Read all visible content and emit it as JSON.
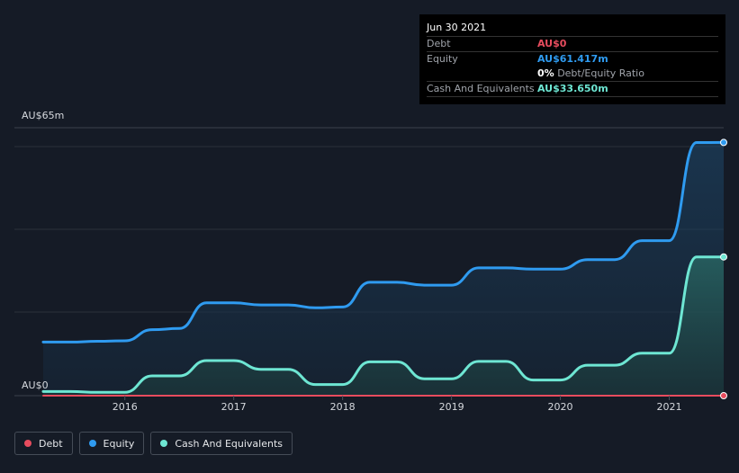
{
  "tooltip": {
    "date": "Jun 30 2021",
    "rows": [
      {
        "label": "Debt",
        "value": "AU$0",
        "color": "#e74c5e"
      },
      {
        "label": "Equity",
        "value": "AU$61.417m",
        "color": "#2f9bf0"
      },
      {
        "ratio_value": "0%",
        "ratio_label": "Debt/Equity Ratio"
      },
      {
        "label": "Cash And Equivalents",
        "value": "AU$33.650m",
        "color": "#6ee6d3"
      }
    ]
  },
  "legend": [
    {
      "label": "Debt",
      "color": "#e74c5e"
    },
    {
      "label": "Equity",
      "color": "#2f9bf0"
    },
    {
      "label": "Cash And Equivalents",
      "color": "#6ee6d3"
    }
  ],
  "chart_data": {
    "type": "area",
    "y_axis_labels": [
      "AU$65m",
      "AU$0"
    ],
    "x_tick_labels": [
      "2016",
      "2017",
      "2018",
      "2019",
      "2020",
      "2021"
    ],
    "ylim": [
      0,
      65
    ],
    "xlim": [
      2015.25,
      2021.5
    ],
    "grid": true,
    "series": [
      {
        "name": "Debt",
        "color": "#e74c5e",
        "fill": false,
        "x": [
          2015.25,
          2021.5
        ],
        "values": [
          0,
          0
        ]
      },
      {
        "name": "Equity",
        "color": "#2f9bf0",
        "fill": true,
        "x": [
          2015.25,
          2015.5,
          2015.75,
          2016.0,
          2016.25,
          2016.5,
          2016.75,
          2017.0,
          2017.25,
          2017.5,
          2017.75,
          2018.0,
          2018.25,
          2018.5,
          2018.75,
          2019.0,
          2019.25,
          2019.5,
          2019.75,
          2020.0,
          2020.25,
          2020.5,
          2020.75,
          2021.0,
          2021.25,
          2021.5
        ],
        "values": [
          13,
          13,
          13.2,
          13.3,
          16,
          16.3,
          22.5,
          22.5,
          22,
          22,
          21.3,
          21.5,
          27.5,
          27.5,
          26.8,
          26.8,
          31,
          31,
          30.7,
          30.7,
          33,
          33,
          37.6,
          37.6,
          61.4,
          61.417
        ]
      },
      {
        "name": "Cash And Equivalents",
        "color": "#6ee6d3",
        "fill": true,
        "x": [
          2015.25,
          2015.5,
          2015.75,
          2016.0,
          2016.25,
          2016.5,
          2016.75,
          2017.0,
          2017.25,
          2017.5,
          2017.75,
          2018.0,
          2018.25,
          2018.5,
          2018.75,
          2019.0,
          2019.25,
          2019.5,
          2019.75,
          2020.0,
          2020.25,
          2020.5,
          2020.75,
          2021.0,
          2021.25,
          2021.5
        ],
        "values": [
          1,
          1,
          0.8,
          0.8,
          4.8,
          4.8,
          8.5,
          8.5,
          6.4,
          6.4,
          2.7,
          2.7,
          8.2,
          8.2,
          4.1,
          4.1,
          8.3,
          8.3,
          3.8,
          3.8,
          7.4,
          7.4,
          10.3,
          10.3,
          33.65,
          33.65
        ]
      }
    ]
  }
}
